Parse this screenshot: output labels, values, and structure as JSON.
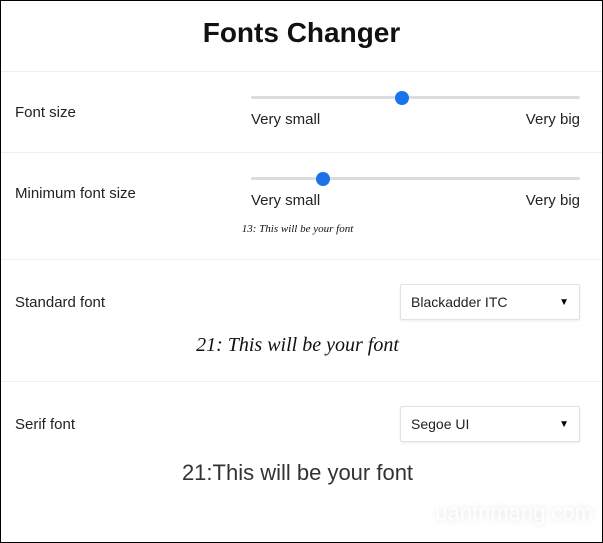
{
  "title": "Fonts Changer",
  "sections": {
    "fontSize": {
      "label": "Font size",
      "min": "Very small",
      "max": "Very big",
      "thumbPct": 46
    },
    "minFontSize": {
      "label": "Minimum font size",
      "min": "Very small",
      "max": "Very big",
      "thumbPct": 22,
      "preview": "13: This will be your font"
    },
    "standardFont": {
      "label": "Standard font",
      "value": "Blackadder ITC",
      "preview": "21: This will be your font"
    },
    "serifFont": {
      "label": "Serif font",
      "value": "Segoe UI",
      "preview": "21:This will be your font"
    }
  },
  "watermark": "uantrimang.com"
}
